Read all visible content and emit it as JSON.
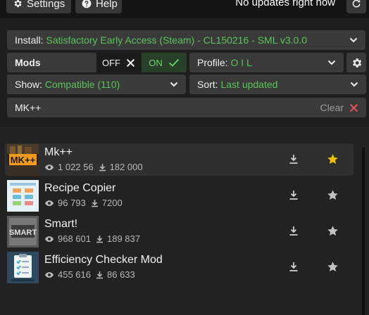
{
  "topbar": {
    "settings_label": "Settings",
    "help_label": "Help",
    "status_text": "No updates right now"
  },
  "install": {
    "label": "Install:",
    "value": "Satisfactory Early Access (Steam) - CL150216 - SML v3.0.0"
  },
  "mods": {
    "label": "Mods",
    "off_label": "OFF",
    "on_label": "ON",
    "state": "ON"
  },
  "profile": {
    "label": "Profile:",
    "value": "O I L"
  },
  "show": {
    "label": "Show:",
    "value": "Compatible (110)"
  },
  "sort": {
    "label": "Sort:",
    "value": "Last updated"
  },
  "search": {
    "value": "MK++",
    "clear_label": "Clear"
  },
  "mod_list": [
    {
      "name": "Mk++",
      "views": "1 022 56",
      "downloads": "182 000",
      "favorite": true,
      "selected": true,
      "thumb_icon": "mk-plus-plus-logo"
    },
    {
      "name": "Recipe Copier",
      "views": "96 793",
      "downloads": "7200",
      "favorite": false,
      "selected": false,
      "thumb_icon": "recipe-copier-logo"
    },
    {
      "name": "Smart!",
      "views": "968 601",
      "downloads": "189 837",
      "favorite": false,
      "selected": false,
      "thumb_icon": "smart-logo"
    },
    {
      "name": "Efficiency Checker Mod",
      "views": "455 616",
      "downloads": "86 633",
      "favorite": false,
      "selected": false,
      "thumb_icon": "efficiency-checker-logo"
    }
  ],
  "colors": {
    "accent_green": "#5bc25b",
    "favorite_star": "#f0c000",
    "panel": "#3a3a3a",
    "background": "#1e1e1e"
  }
}
